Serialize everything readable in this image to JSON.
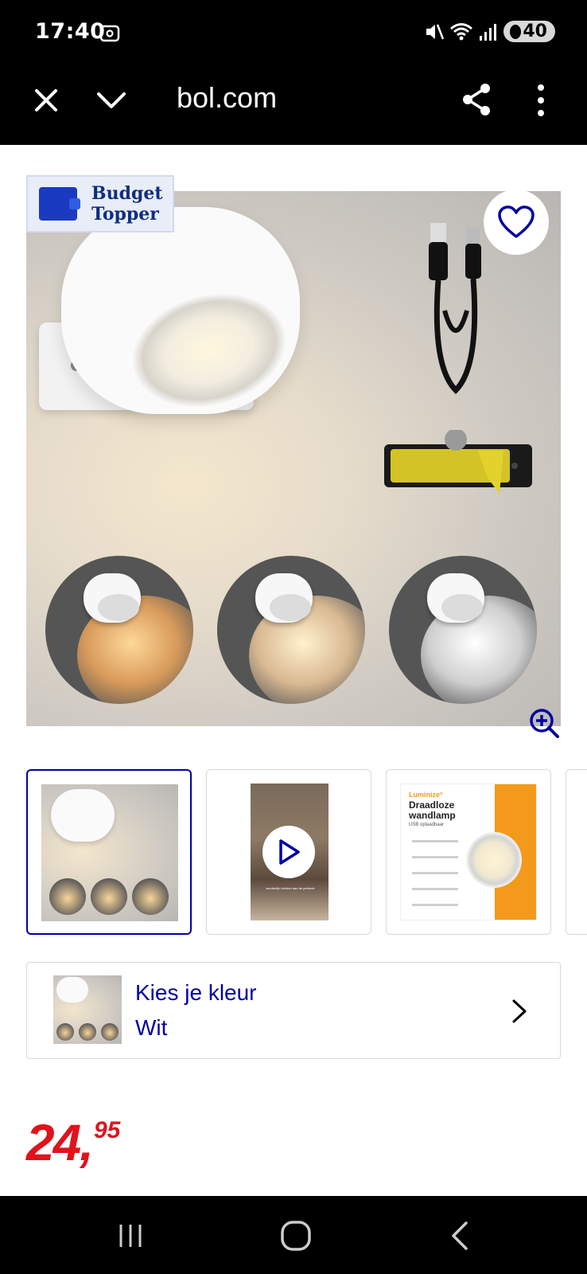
{
  "status_bar": {
    "time": "17:40",
    "battery": "40",
    "icons": [
      "screen-record-icon",
      "mute-icon",
      "wifi-icon",
      "signal-icon",
      "battery-icon"
    ]
  },
  "browser_bar": {
    "url": "bol.com",
    "icons": [
      "close-icon",
      "chevron-down-icon",
      "share-icon",
      "more-vert-icon"
    ]
  },
  "product": {
    "badge": {
      "line1": "Budget",
      "line2": "Topper"
    },
    "favorite_icon": "heart-icon",
    "zoom_icon": "zoom-in-icon",
    "thumbnails": [
      {
        "type": "image",
        "selected": true
      },
      {
        "type": "video",
        "caption": "wonderlijk hebben aan de perfecte"
      },
      {
        "type": "image",
        "brand": "Luminize°",
        "title": "Draadloze wandlamp",
        "subtitle": "USB oplaadbaar"
      },
      {
        "type": "image"
      }
    ],
    "color_picker": {
      "label": "Kies je kleur",
      "value": "Wit"
    },
    "price": {
      "whole": "24",
      "separator": ",",
      "cents": "95"
    }
  },
  "colors": {
    "accent_blue": "#0000a4",
    "price_red": "#e0131c",
    "bar_bg": "#000000"
  },
  "nav_bar": {
    "icons": [
      "recent-apps-icon",
      "home-icon",
      "back-icon"
    ]
  }
}
